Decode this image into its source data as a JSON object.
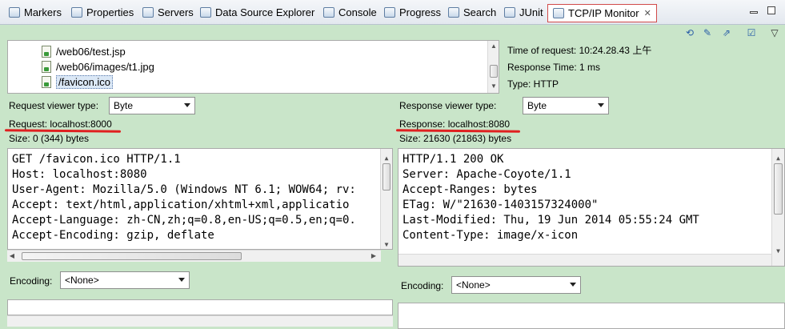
{
  "tabs": [
    {
      "label": "Markers",
      "icon": "markers-icon"
    },
    {
      "label": "Properties",
      "icon": "properties-icon"
    },
    {
      "label": "Servers",
      "icon": "servers-icon"
    },
    {
      "label": "Data Source Explorer",
      "icon": "data-source-icon"
    },
    {
      "label": "Console",
      "icon": "console-icon"
    },
    {
      "label": "Progress",
      "icon": "progress-icon"
    },
    {
      "label": "Search",
      "icon": "search-icon"
    },
    {
      "label": "JUnit",
      "icon": "junit-icon"
    },
    {
      "label": "TCP/IP Monitor",
      "icon": "tcpip-monitor-icon",
      "active": true
    }
  ],
  "requests": [
    {
      "label": "/web06/test.jsp"
    },
    {
      "label": "/web06/images/t1.jpg"
    },
    {
      "label": "/favicon.ico",
      "selected": true
    }
  ],
  "info": {
    "time": "Time of request: 10:24.28.43 上午",
    "response_time": "Response Time: 1 ms",
    "type": "Type: HTTP"
  },
  "request_panel": {
    "viewer_label": "Request viewer type:",
    "viewer_value": "Byte",
    "host": "Request: localhost:8000",
    "size": "Size: 0 (344) bytes",
    "lines": [
      "GET /favicon.ico HTTP/1.1",
      "Host: localhost:8080",
      "User-Agent: Mozilla/5.0 (Windows NT 6.1; WOW64; rv:",
      "Accept: text/html,application/xhtml+xml,applicatio",
      "Accept-Language: zh-CN,zh;q=0.8,en-US;q=0.5,en;q=0.",
      "Accept-Encoding: gzip, deflate"
    ],
    "encoding_label": "Encoding:",
    "encoding_value": "<None>"
  },
  "response_panel": {
    "viewer_label": "Response viewer type:",
    "viewer_value": "Byte",
    "host": "Response: localhost:8080",
    "size": "Size: 21630 (21863) bytes",
    "lines": [
      "HTTP/1.1 200 OK",
      "Server: Apache-Coyote/1.1",
      "Accept-Ranges: bytes",
      "ETag: W/\"21630-1403157324000\"",
      "Last-Modified: Thu, 19 Jun 2014 05:55:24 GMT",
      "Content-Type: image/x-icon"
    ],
    "encoding_label": "Encoding:",
    "encoding_value": "<None>"
  },
  "colors": {
    "panel_bg": "#c9e5c9",
    "annotation": "#e02020",
    "active_tab_border": "#d14a4a"
  }
}
